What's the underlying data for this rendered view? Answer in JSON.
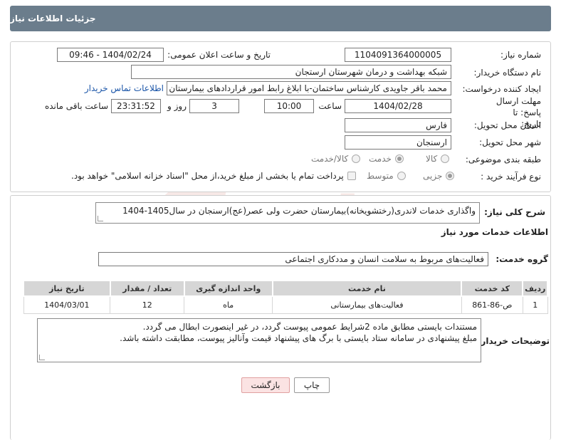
{
  "header": {
    "title": "جزئیات اطلاعات نیاز"
  },
  "form": {
    "need_number_label": "شماره نیاز:",
    "need_number": "1104091364000005",
    "announce_label": "تاریخ و ساعت اعلان عمومی:",
    "announce_value": "1404/02/24 - 09:46",
    "buyer_org_label": "نام دستگاه خریدار:",
    "buyer_org": "شبکه بهداشت و درمان شهرستان ارستجان",
    "creator_label": "ایجاد کننده درخواست:",
    "creator": "محمد باقر جاویدی کارشناس ساختمان-با ابلاغ رابط امور قراردادهای بیمارستان شهدا",
    "contact_link": "اطلاعات تماس خریدار",
    "deadline_label": "مهلت ارسال پاسخ: تا تاریخ:",
    "deadline_date": "1404/02/28",
    "time_label": "ساعت",
    "deadline_time": "10:00",
    "days_value": "3",
    "days_label": "روز و",
    "remaining_time": "23:31:52",
    "remaining_label": "ساعت باقی مانده",
    "province_label": "استان محل تحویل:",
    "province": "فارس",
    "city_label": "شهر محل تحویل:",
    "city": "ارسنجان",
    "category_label": "طبقه بندی موضوعی:",
    "category_options": [
      "کالا",
      "خدمت",
      "کالا/خدمت"
    ],
    "category_selected": "خدمت",
    "process_label": "نوع فرآیند خرید :",
    "process_options": [
      "جزیی",
      "متوسط"
    ],
    "process_selected": "جزیی",
    "payment_note": "پرداخت تمام یا بخشی از مبلغ خرید،از محل \"اسناد خزانه اسلامی\" خواهد بود."
  },
  "description": {
    "label": "شرح کلی نیاز:",
    "text": "واگذاری خدمات لاندری(رختشویخانه)بیمارستان حضرت ولی عصر(عج)ارسنجان در سال1405-1404"
  },
  "services": {
    "section_title": "اطلاعات خدمات مورد نیاز",
    "group_label": "گروه خدمت:",
    "group_value": "فعالیت‌های مربوط به سلامت انسان و مددکاری اجتماعی",
    "columns": [
      "ردیف",
      "کد خدمت",
      "نام خدمت",
      "واحد اندازه گیری",
      "تعداد / مقدار",
      "تاریخ نیاز"
    ],
    "rows": [
      [
        "1",
        "ص-86-861",
        "فعالیت‌های بیمارستانی",
        "ماه",
        "12",
        "1404/03/01"
      ]
    ]
  },
  "buyer_notes": {
    "label": "توضیحات خریدار:",
    "line1": "مستندات بایستی مطابق ماده 2شرایط عمومی پیوست گردد، در غیر اینصورت ابطال می گردد.",
    "line2": "مبلغ پیشنهادی در سامانه ستاد بایستی با برگ های پیشنهاد قیمت وآنالیز پیوست، مطابقت داشته باشد."
  },
  "buttons": {
    "print": "چاپ",
    "back": "بازگشت"
  },
  "colors": {
    "header_bg": "#6b7d8c",
    "link": "#1a55a8",
    "back_button_bg": "#fbe3e3",
    "watermark": "#c0392b"
  },
  "watermark": {
    "text": "AriaTender.neT"
  }
}
